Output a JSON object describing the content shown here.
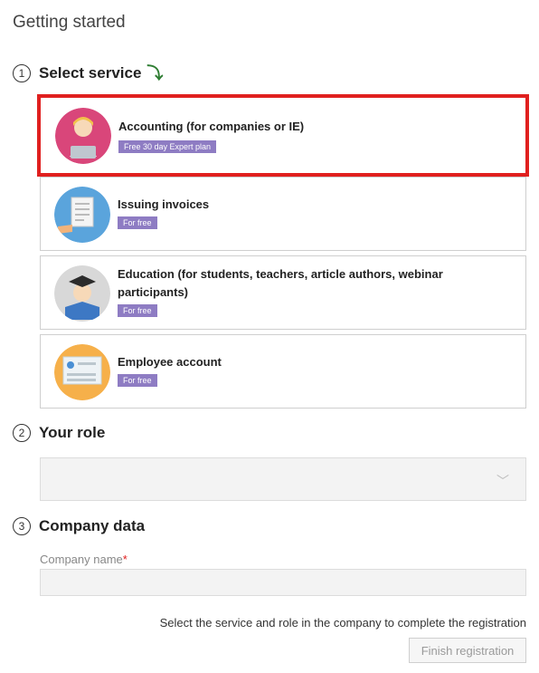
{
  "page": {
    "title": "Getting started"
  },
  "steps": [
    {
      "number": "1",
      "label": "Select service"
    },
    {
      "number": "2",
      "label": "Your role"
    },
    {
      "number": "3",
      "label": "Company data"
    }
  ],
  "services": [
    {
      "title": "Accounting (for companies or IE)",
      "badge": "Free 30 day Expert plan",
      "selected": true,
      "icon": "accountant-avatar-icon",
      "color": "#d9467a"
    },
    {
      "title": "Issuing invoices",
      "badge": "For free",
      "selected": false,
      "icon": "invoice-icon",
      "color": "#5aa4dc"
    },
    {
      "title": "Education (for students, teachers, article authors, webinar participants)",
      "badge": "For free",
      "selected": false,
      "icon": "graduate-icon",
      "color": "#d8d8d8"
    },
    {
      "title": "Employee account",
      "badge": "For free",
      "selected": false,
      "icon": "employee-card-icon",
      "color": "#f6b04a"
    }
  ],
  "role": {
    "value": ""
  },
  "company": {
    "name_label": "Company name",
    "required_mark": "*",
    "name_value": ""
  },
  "footer": {
    "hint": "Select the service and role in the company to complete the registration",
    "finish_label": "Finish registration"
  },
  "colors": {
    "selected_border": "#e0201f",
    "badge_bg": "#8e7cc3",
    "arrow": "#2e7d32"
  }
}
